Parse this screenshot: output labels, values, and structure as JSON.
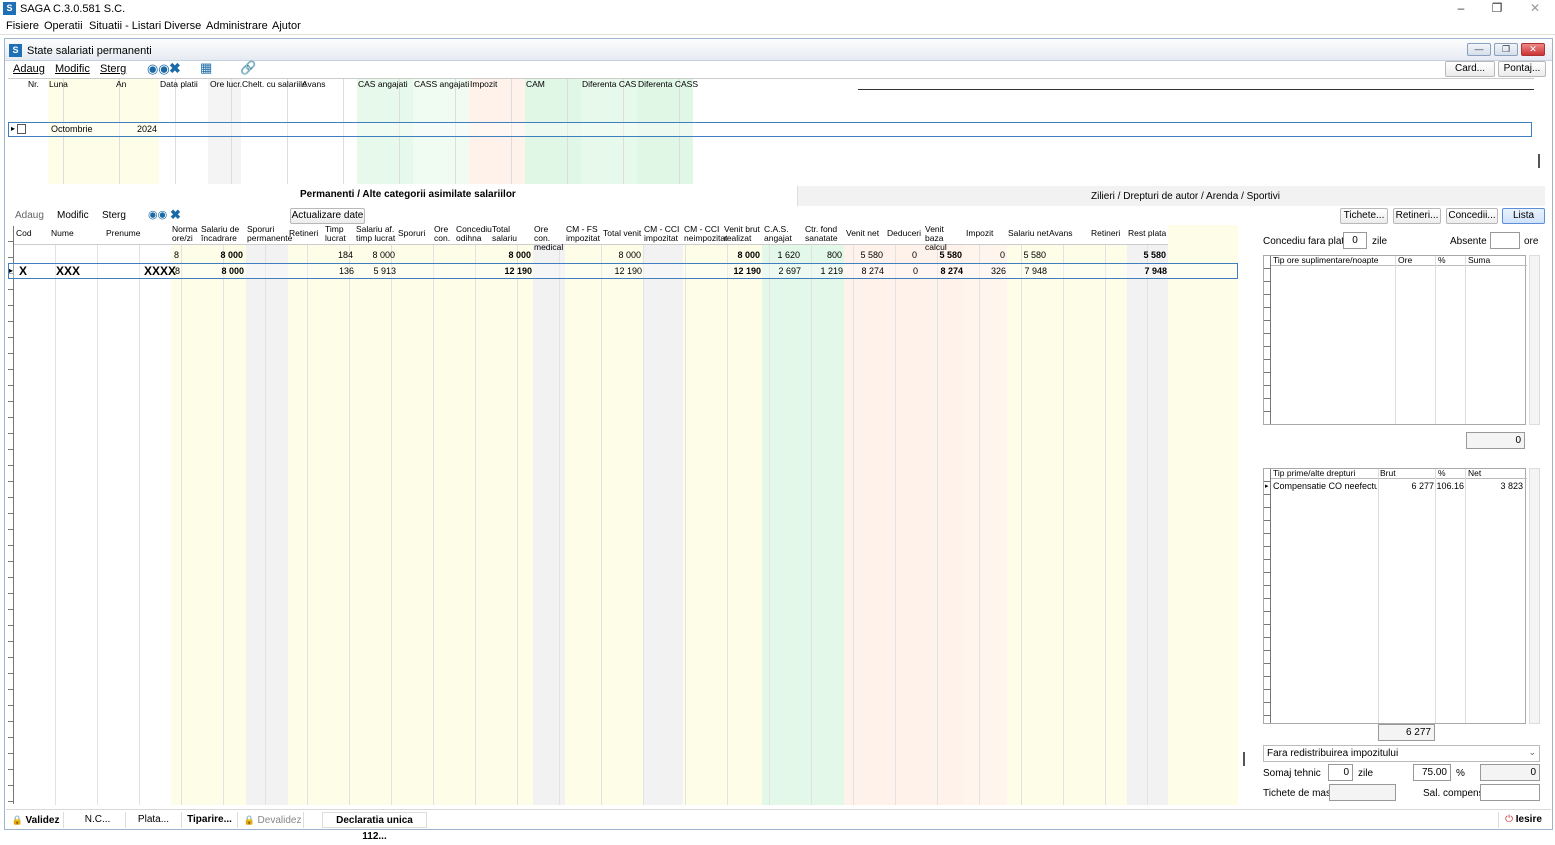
{
  "app": {
    "title": "SAGA C.3.0.581  S.C."
  },
  "menu": [
    "Fisiere",
    "Operatii",
    "Situatii - Listari",
    "Diverse",
    "Administrare",
    "Ajutor"
  ],
  "window": {
    "title": "State salariati permanenti"
  },
  "toolbar": {
    "add": "Adaug",
    "modify": "Modific",
    "delete": "Sterg",
    "card": "Card...",
    "pontaj": "Pontaj..."
  },
  "top_grid": {
    "headers": [
      "Nr.",
      "Luna",
      "An",
      "Data platii",
      "Ore lucr.",
      "Chelt. cu salariile",
      "Avans",
      "CAS angajati",
      "CASS angajati",
      "Impozit",
      "CAM",
      "Diferenta CAS",
      "Diferenta CASS"
    ],
    "row": {
      "luna": "Octombrie",
      "an": "2024"
    }
  },
  "tabs": {
    "left": "Permanenti / Alte categorii asimilate salariilor",
    "right": "Zilieri / Drepturi de autor / Arenda / Sportivi"
  },
  "toolbar2": {
    "add": "Adaug",
    "modify": "Modific",
    "delete": "Sterg",
    "update": "Actualizare date"
  },
  "right_buttons": {
    "tichete": "Tichete...",
    "retineri": "Retineri...",
    "concedii": "Concedii...",
    "lista": "Lista"
  },
  "main_grid": {
    "headers": [
      "Cod",
      "Nume",
      "Prenume",
      "Norma ore/zi",
      "Salariu de încadrare",
      "Sporuri permanente",
      "Retineri",
      "Timp lucrat",
      "Salariu af. timp lucrat",
      "Sporuri",
      "Ore con.",
      "Concediu odihna",
      "Total salariu",
      "Ore con. medical",
      "CM - FS impozitat",
      "Total venit",
      "CM - CCI impozitat",
      "CM - CCI neimpozitat",
      "Venit brut realizat",
      "C.A.S. angajat",
      "Ctr. fond sanatate",
      "Venit net",
      "Deduceri",
      "Venit baza calcul",
      "Impozit",
      "Salariu net",
      "Avans",
      "Retineri",
      "Rest plata"
    ],
    "totals": {
      "norma": "8",
      "salariu": "8 000",
      "timp": "184",
      "salaf": "8 000",
      "totalsal": "8 000",
      "totalvenit": "8 000",
      "venitbrut": "8 000",
      "cas": "1 620",
      "cass": "800",
      "venitnet": "5 580",
      "deduceri": "0",
      "baza": "5 580",
      "impozit": "0",
      "salnet": "5 580",
      "rest": "5 580"
    },
    "row": {
      "cod": "X",
      "nume": "XXX",
      "prenume": "XXXX",
      "norma": "8",
      "salariu": "8 000",
      "timp": "136",
      "salaf": "5 913",
      "totalsal": "12 190",
      "totalvenit": "12 190",
      "venitbrut": "12 190",
      "cas": "2 697",
      "cass": "1 219",
      "venitnet": "8 274",
      "deduceri": "0",
      "baza": "8 274",
      "impozit": "326",
      "salnet": "7 948",
      "rest": "7 948"
    }
  },
  "right_panel": {
    "concediu_label": "Concediu fara plata",
    "concediu_value": "0",
    "zile": "zile",
    "absente_label": "Absente",
    "ore": "ore",
    "ore_grid_headers": [
      "Tip ore suplimentare/noapte",
      "Ore",
      "%",
      "Suma"
    ],
    "ore_total": "0",
    "prime_headers": [
      "Tip prime/alte drepturi",
      "Brut",
      "%",
      "Net"
    ],
    "prime_row": {
      "tip": "Compensatie CO neefectu",
      "brut": "6 277",
      "pct": "106.16",
      "net": "3 823"
    },
    "prime_total": "6 277",
    "redistribuire": "Fara redistribuirea impozitului",
    "somaj_label": "Somaj tehnic",
    "somaj_zile": "0",
    "somaj_zile_label": "zile",
    "somaj_pct": "75.00",
    "pct_sign": "%",
    "somaj_val": "0",
    "tichete_label": "Tichete de masa",
    "sal_compens_label": "Sal. compens."
  },
  "bottom": {
    "valid": "Validez",
    "nc": "N.C...",
    "plata": "Plata...",
    "tiparire": "Tiparire...",
    "devalid": "Devalidez",
    "declaratia": "Declaratia unica 112...",
    "iesire": "Iesire"
  }
}
